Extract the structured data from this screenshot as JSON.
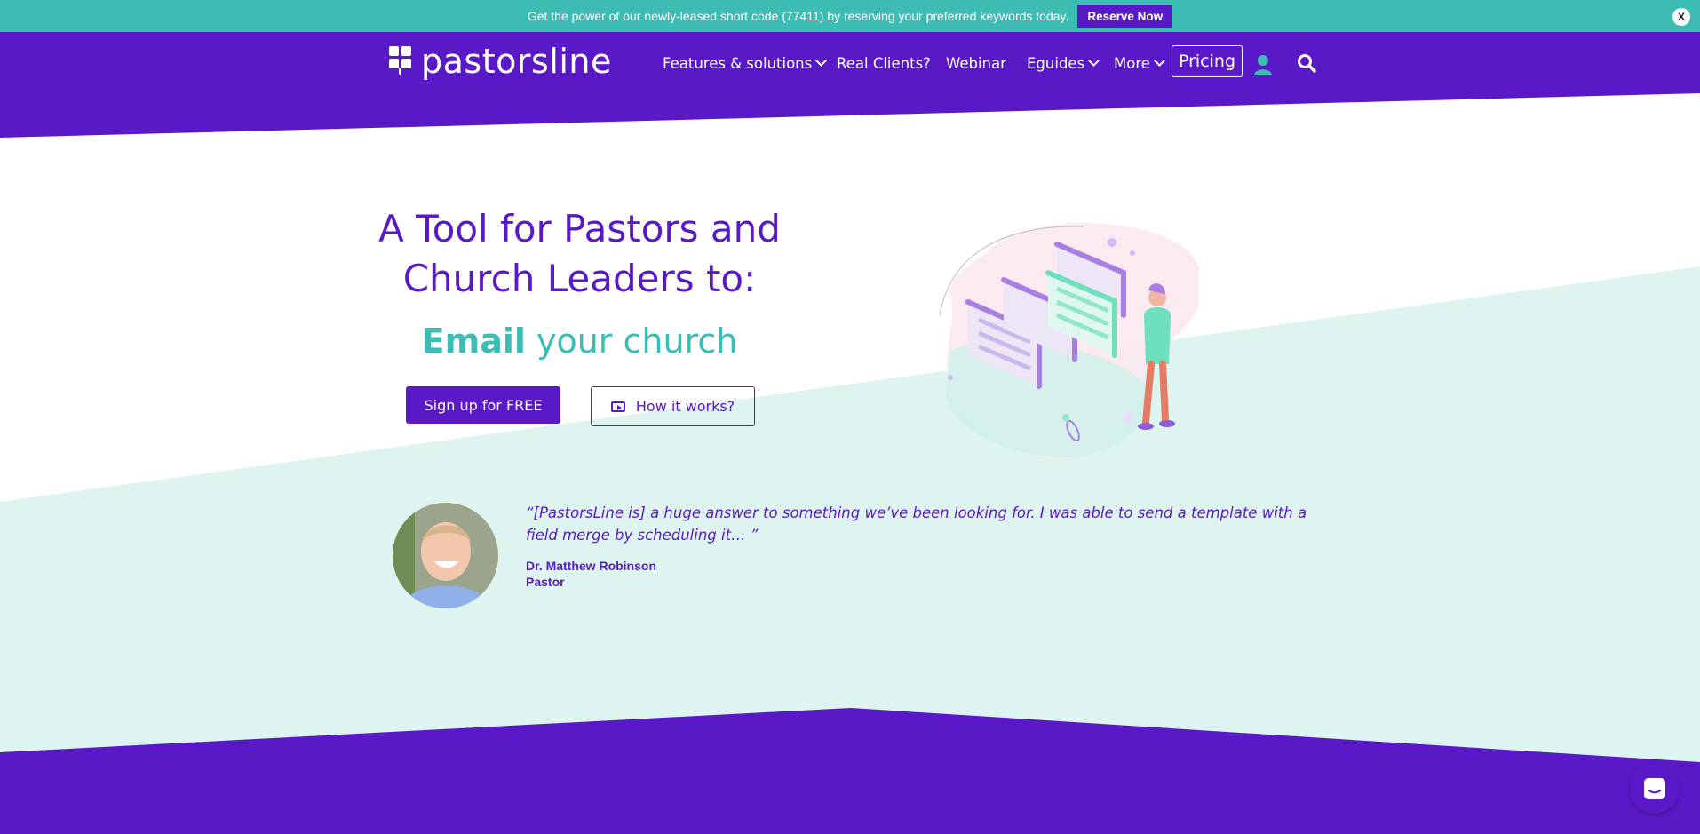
{
  "announcement": {
    "text": "Get the power of our newly-leased short code (77411) by reserving your preferred keywords today.",
    "button_label": "Reserve Now",
    "close_label": "X"
  },
  "header": {
    "logo_text": "pastorsline",
    "nav": [
      {
        "label": "Features & solutions",
        "has_dropdown": true
      },
      {
        "label": "Real Clients?",
        "has_dropdown": false
      },
      {
        "label": "Webinar",
        "has_dropdown": false
      },
      {
        "label": "Eguides",
        "has_dropdown": true
      },
      {
        "label": "More",
        "has_dropdown": true
      }
    ],
    "pricing_label": "Pricing",
    "icons": [
      "user-icon",
      "search-icon"
    ]
  },
  "hero": {
    "headline_line1": "A Tool for Pastors and",
    "headline_line2": "Church Leaders to:",
    "sub_bold": "Email",
    "sub_rest": " your church",
    "signup_label": "Sign up for FREE",
    "how_label": "How it works?"
  },
  "testimonial": {
    "quote": "“[PastorsLine is] a huge answer to something we’ve been looking for. I was able to send a template with a field merge by scheduling it… ”",
    "name": "Dr. Matthew Robinson",
    "role": "Pastor"
  },
  "colors": {
    "purple": "#5a19c6",
    "teal": "#3dbcb4",
    "light_teal": "#ddf4f1"
  }
}
